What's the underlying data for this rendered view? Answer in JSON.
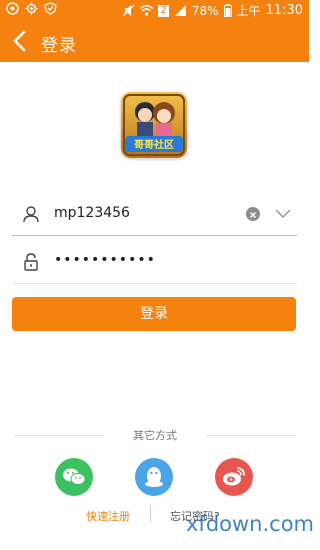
{
  "status_bar": {
    "battery": "78%",
    "period": "上午",
    "time": "11:30",
    "sim": "2"
  },
  "header": {
    "title": "登录",
    "accent_color": "#f5820f"
  },
  "app_logo": {
    "text": "哥哥社区"
  },
  "form": {
    "username": {
      "value": "mp123456"
    },
    "password": {
      "value": "•••••••••••"
    },
    "login_button": "登录"
  },
  "other_methods": {
    "label": "其它方式",
    "providers": [
      "wechat",
      "qq",
      "weibo"
    ]
  },
  "footer": {
    "quick_register": "快速注册",
    "forgot_password": "忘记密码?",
    "watermark": "xfdown.com"
  }
}
